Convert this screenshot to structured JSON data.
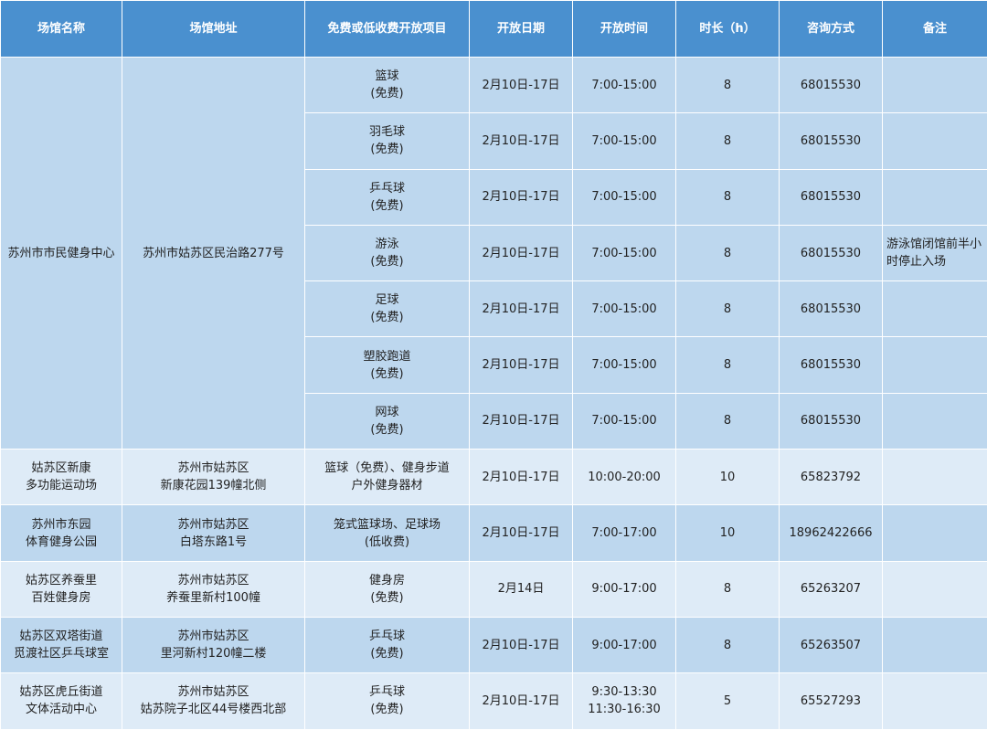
{
  "headers": [
    "场馆名称",
    "场馆地址",
    "免费或低收费开放项目",
    "开放日期",
    "开放时间",
    "时长（h）",
    "咨询方式",
    "备注"
  ],
  "venue1": {
    "name": [
      "苏州市市民健身中心"
    ],
    "address": [
      "苏州市姑苏区民治路277号"
    ],
    "note": [
      "游泳馆闭馆前半小",
      "时停止入场"
    ],
    "rows": [
      {
        "item": [
          "篮球",
          "(免费)"
        ],
        "date": "2月10日-17日",
        "time": [
          "7:00-15:00"
        ],
        "hours": "8",
        "phone": "68015530"
      },
      {
        "item": [
          "羽毛球",
          "(免费)"
        ],
        "date": "2月10日-17日",
        "time": [
          "7:00-15:00"
        ],
        "hours": "8",
        "phone": "68015530"
      },
      {
        "item": [
          "乒乓球",
          "(免费)"
        ],
        "date": "2月10日-17日",
        "time": [
          "7:00-15:00"
        ],
        "hours": "8",
        "phone": "68015530"
      },
      {
        "item": [
          "游泳",
          "(免费)"
        ],
        "date": "2月10日-17日",
        "time": [
          "7:00-15:00"
        ],
        "hours": "8",
        "phone": "68015530"
      },
      {
        "item": [
          "足球",
          "(免费)"
        ],
        "date": "2月10日-17日",
        "time": [
          "7:00-15:00"
        ],
        "hours": "8",
        "phone": "68015530"
      },
      {
        "item": [
          "塑胶跑道",
          "(免费)"
        ],
        "date": "2月10日-17日",
        "time": [
          "7:00-15:00"
        ],
        "hours": "8",
        "phone": "68015530"
      },
      {
        "item": [
          "网球",
          "(免费)"
        ],
        "date": "2月10日-17日",
        "time": [
          "7:00-15:00"
        ],
        "hours": "8",
        "phone": "68015530"
      }
    ]
  },
  "others": [
    {
      "name": [
        "姑苏区新康",
        "多功能运动场"
      ],
      "address": [
        "苏州市姑苏区",
        "新康花园139幢北侧"
      ],
      "item": [
        "篮球（免费）、健身步道",
        "户外健身器材"
      ],
      "date": "2月10日-17日",
      "time": [
        "10:00-20:00"
      ],
      "hours": "10",
      "phone": "65823792",
      "note": ""
    },
    {
      "name": [
        "苏州市东园",
        "体育健身公园"
      ],
      "address": [
        "苏州市姑苏区",
        "白塔东路1号"
      ],
      "item": [
        "笼式篮球场、足球场",
        "(低收费)"
      ],
      "date": "2月10日-17日",
      "time": [
        "7:00-17:00"
      ],
      "hours": "10",
      "phone": "18962422666",
      "note": ""
    },
    {
      "name": [
        "姑苏区养蚕里",
        "百姓健身房"
      ],
      "address": [
        "苏州市姑苏区",
        "养蚕里新村100幢"
      ],
      "item": [
        "健身房",
        "(免费)"
      ],
      "date": "2月14日",
      "time": [
        "9:00-17:00"
      ],
      "hours": "8",
      "phone": "65263207",
      "note": ""
    },
    {
      "name": [
        "姑苏区双塔街道",
        "觅渡社区乒乓球室"
      ],
      "address": [
        "苏州市姑苏区",
        "里河新村120幢二楼"
      ],
      "item": [
        "乒乓球",
        "(免费)"
      ],
      "date": "2月10日-17日",
      "time": [
        "9:00-17:00"
      ],
      "hours": "8",
      "phone": "65263507",
      "note": ""
    },
    {
      "name": [
        "姑苏区虎丘街道",
        "文体活动中心"
      ],
      "address": [
        "苏州市姑苏区",
        "姑苏院子北区44号楼西北部"
      ],
      "item": [
        "乒乓球",
        "(免费)"
      ],
      "date": "2月10日-17日",
      "time": [
        "9:30-13:30",
        "11:30-16:30"
      ],
      "hours": "5",
      "phone": "65527293",
      "note": ""
    }
  ]
}
